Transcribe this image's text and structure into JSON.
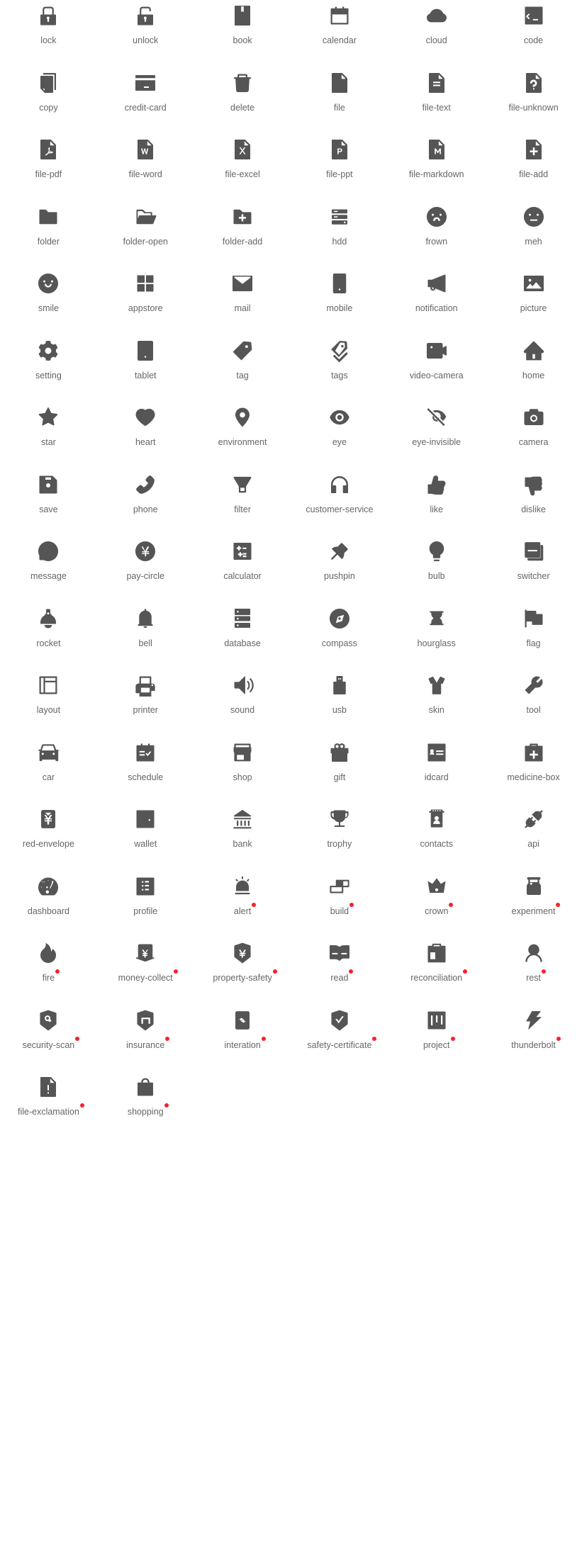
{
  "page": {
    "title": "Icon gallery",
    "columns": 6,
    "icon_color": "#555555",
    "label_color": "#666666",
    "badge_color": "#f5222d",
    "background": "#ffffff"
  },
  "icons": [
    {
      "label": "lock",
      "icon": "lock-icon",
      "badge": false
    },
    {
      "label": "unlock",
      "icon": "unlock-icon",
      "badge": false
    },
    {
      "label": "book",
      "icon": "book-icon",
      "badge": false
    },
    {
      "label": "calendar",
      "icon": "calendar-icon",
      "badge": false
    },
    {
      "label": "cloud",
      "icon": "cloud-icon",
      "badge": false
    },
    {
      "label": "code",
      "icon": "code-icon",
      "badge": false
    },
    {
      "label": "copy",
      "icon": "copy-icon",
      "badge": false
    },
    {
      "label": "credit-card",
      "icon": "credit-card-icon",
      "badge": false
    },
    {
      "label": "delete",
      "icon": "delete-icon",
      "badge": false
    },
    {
      "label": "file",
      "icon": "file-icon",
      "badge": false
    },
    {
      "label": "file-text",
      "icon": "file-text-icon",
      "badge": false
    },
    {
      "label": "file-unknown",
      "icon": "file-unknown-icon",
      "badge": false
    },
    {
      "label": "file-pdf",
      "icon": "file-pdf-icon",
      "badge": false
    },
    {
      "label": "file-word",
      "icon": "file-word-icon",
      "badge": false
    },
    {
      "label": "file-excel",
      "icon": "file-excel-icon",
      "badge": false
    },
    {
      "label": "file-ppt",
      "icon": "file-ppt-icon",
      "badge": false
    },
    {
      "label": "file-markdown",
      "icon": "file-markdown-icon",
      "badge": false
    },
    {
      "label": "file-add",
      "icon": "file-add-icon",
      "badge": false
    },
    {
      "label": "folder",
      "icon": "folder-icon",
      "badge": false
    },
    {
      "label": "folder-open",
      "icon": "folder-open-icon",
      "badge": false
    },
    {
      "label": "folder-add",
      "icon": "folder-add-icon",
      "badge": false
    },
    {
      "label": "hdd",
      "icon": "hdd-icon",
      "badge": false
    },
    {
      "label": "frown",
      "icon": "frown-icon",
      "badge": false
    },
    {
      "label": "meh",
      "icon": "meh-icon",
      "badge": false
    },
    {
      "label": "smile",
      "icon": "smile-icon",
      "badge": false
    },
    {
      "label": "appstore",
      "icon": "appstore-icon",
      "badge": false
    },
    {
      "label": "mail",
      "icon": "mail-icon",
      "badge": false
    },
    {
      "label": "mobile",
      "icon": "mobile-icon",
      "badge": false
    },
    {
      "label": "notification",
      "icon": "notification-icon",
      "badge": false
    },
    {
      "label": "picture",
      "icon": "picture-icon",
      "badge": false
    },
    {
      "label": "setting",
      "icon": "setting-icon",
      "badge": false
    },
    {
      "label": "tablet",
      "icon": "tablet-icon",
      "badge": false
    },
    {
      "label": "tag",
      "icon": "tag-icon",
      "badge": false
    },
    {
      "label": "tags",
      "icon": "tags-icon",
      "badge": false
    },
    {
      "label": "video-camera",
      "icon": "video-camera-icon",
      "badge": false
    },
    {
      "label": "home",
      "icon": "home-icon",
      "badge": false
    },
    {
      "label": "star",
      "icon": "star-icon",
      "badge": false
    },
    {
      "label": "heart",
      "icon": "heart-icon",
      "badge": false
    },
    {
      "label": "environment",
      "icon": "environment-icon",
      "badge": false
    },
    {
      "label": "eye",
      "icon": "eye-icon",
      "badge": false
    },
    {
      "label": "eye-invisible",
      "icon": "eye-invisible-icon",
      "badge": false
    },
    {
      "label": "camera",
      "icon": "camera-icon",
      "badge": false
    },
    {
      "label": "save",
      "icon": "save-icon",
      "badge": false
    },
    {
      "label": "phone",
      "icon": "phone-icon",
      "badge": false
    },
    {
      "label": "filter",
      "icon": "filter-icon",
      "badge": false
    },
    {
      "label": "customer-service",
      "icon": "customer-service-icon",
      "badge": false
    },
    {
      "label": "like",
      "icon": "like-icon",
      "badge": false
    },
    {
      "label": "dislike",
      "icon": "dislike-icon",
      "badge": false
    },
    {
      "label": "message",
      "icon": "message-icon",
      "badge": false
    },
    {
      "label": "pay-circle",
      "icon": "pay-circle-icon",
      "badge": false
    },
    {
      "label": "calculator",
      "icon": "calculator-icon",
      "badge": false
    },
    {
      "label": "pushpin",
      "icon": "pushpin-icon",
      "badge": false
    },
    {
      "label": "bulb",
      "icon": "bulb-icon",
      "badge": false
    },
    {
      "label": "switcher",
      "icon": "switcher-icon",
      "badge": false
    },
    {
      "label": "rocket",
      "icon": "rocket-icon",
      "badge": false
    },
    {
      "label": "bell",
      "icon": "bell-icon",
      "badge": false
    },
    {
      "label": "database",
      "icon": "database-icon",
      "badge": false
    },
    {
      "label": "compass",
      "icon": "compass-icon",
      "badge": false
    },
    {
      "label": "hourglass",
      "icon": "hourglass-icon",
      "badge": false
    },
    {
      "label": "flag",
      "icon": "flag-icon",
      "badge": false
    },
    {
      "label": "layout",
      "icon": "layout-icon",
      "badge": false
    },
    {
      "label": "printer",
      "icon": "printer-icon",
      "badge": false
    },
    {
      "label": "sound",
      "icon": "sound-icon",
      "badge": false
    },
    {
      "label": "usb",
      "icon": "usb-icon",
      "badge": false
    },
    {
      "label": "skin",
      "icon": "skin-icon",
      "badge": false
    },
    {
      "label": "tool",
      "icon": "tool-icon",
      "badge": false
    },
    {
      "label": "car",
      "icon": "car-icon",
      "badge": false
    },
    {
      "label": "schedule",
      "icon": "schedule-icon",
      "badge": false
    },
    {
      "label": "shop",
      "icon": "shop-icon",
      "badge": false
    },
    {
      "label": "gift",
      "icon": "gift-icon",
      "badge": false
    },
    {
      "label": "idcard",
      "icon": "idcard-icon",
      "badge": false
    },
    {
      "label": "medicine-box",
      "icon": "medicine-box-icon",
      "badge": false
    },
    {
      "label": "red-envelope",
      "icon": "red-envelope-icon",
      "badge": false
    },
    {
      "label": "wallet",
      "icon": "wallet-icon",
      "badge": false
    },
    {
      "label": "bank",
      "icon": "bank-icon",
      "badge": false
    },
    {
      "label": "trophy",
      "icon": "trophy-icon",
      "badge": false
    },
    {
      "label": "contacts",
      "icon": "contacts-icon",
      "badge": false
    },
    {
      "label": "api",
      "icon": "api-icon",
      "badge": false
    },
    {
      "label": "dashboard",
      "icon": "dashboard-icon",
      "badge": false
    },
    {
      "label": "profile",
      "icon": "profile-icon",
      "badge": false
    },
    {
      "label": "alert",
      "icon": "alert-icon",
      "badge": true
    },
    {
      "label": "build",
      "icon": "build-icon",
      "badge": true
    },
    {
      "label": "crown",
      "icon": "crown-icon",
      "badge": true
    },
    {
      "label": "experiment",
      "icon": "experiment-icon",
      "badge": true
    },
    {
      "label": "fire",
      "icon": "fire-icon",
      "badge": true
    },
    {
      "label": "money-collect",
      "icon": "money-collect-icon",
      "badge": true
    },
    {
      "label": "property-safety",
      "icon": "property-safety-icon",
      "badge": true
    },
    {
      "label": "read",
      "icon": "read-icon",
      "badge": true
    },
    {
      "label": "reconciliation",
      "icon": "reconciliation-icon",
      "badge": true
    },
    {
      "label": "rest",
      "icon": "rest-icon",
      "badge": true
    },
    {
      "label": "security-scan",
      "icon": "security-scan-icon",
      "badge": true
    },
    {
      "label": "insurance",
      "icon": "insurance-icon",
      "badge": true
    },
    {
      "label": "interation",
      "icon": "interation-icon",
      "badge": true
    },
    {
      "label": "safety-certificate",
      "icon": "safety-certificate-icon",
      "badge": true
    },
    {
      "label": "project",
      "icon": "project-icon",
      "badge": true
    },
    {
      "label": "thunderbolt",
      "icon": "thunderbolt-icon",
      "badge": true
    },
    {
      "label": "file-exclamation",
      "icon": "file-exclamation-icon",
      "badge": true
    },
    {
      "label": "shopping",
      "icon": "shopping-icon",
      "badge": true
    }
  ]
}
